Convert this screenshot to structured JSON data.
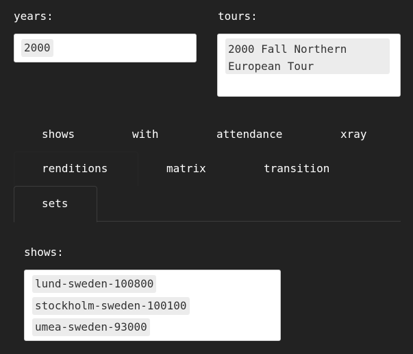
{
  "filters": {
    "years_label": "years:",
    "years_selected": [
      "2000"
    ],
    "tours_label": "tours:",
    "tours_selected_line1": "2000 Fall Northern",
    "tours_selected_line2": "European Tour"
  },
  "tabs": {
    "row1": [
      "shows",
      "with",
      "attendance",
      "xray"
    ],
    "row2": [
      "renditions",
      "matrix",
      "transition"
    ],
    "row3": [
      "sets"
    ],
    "active": "sets"
  },
  "content": {
    "shows_label": "shows:",
    "shows_selected": [
      "lund-sweden-100800",
      "stockholm-sweden-100100",
      "umea-sweden-93000"
    ]
  },
  "colors": {
    "background": "#222222",
    "text": "#ffffff",
    "chip": "#ececec",
    "box": "#ffffff"
  }
}
